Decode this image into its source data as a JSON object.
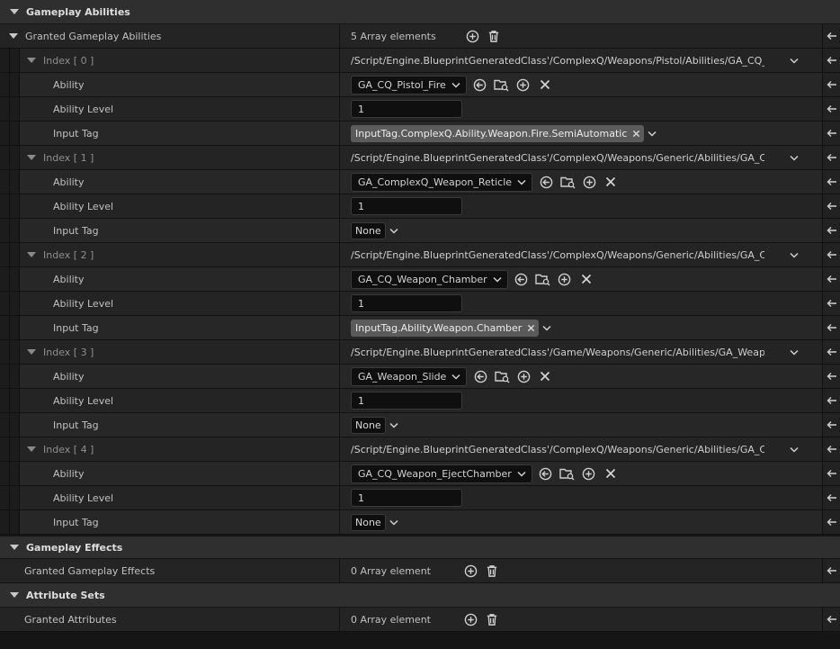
{
  "sections": [
    {
      "title": "Gameplay Abilities"
    },
    {
      "title": "Gameplay Effects"
    },
    {
      "title": "Attribute Sets"
    }
  ],
  "granted_abilities": {
    "label": "Granted Gameplay Abilities",
    "count_text": "5 Array elements",
    "items": [
      {
        "index_label": "Index [ 0 ]",
        "class_path": "/Script/Engine.BlueprintGeneratedClass'/ComplexQ/Weapons/Pistol/Abilities/GA_CQ_Pisto",
        "ability_label": "Ability",
        "ability": "GA_CQ_Pistol_Fire",
        "level_label": "Ability Level",
        "level": "1",
        "tag_label": "Input Tag",
        "tag": "InputTag.ComplexQ.Ability.Weapon.Fire.SemiAutomatic"
      },
      {
        "index_label": "Index [ 1 ]",
        "class_path": "/Script/Engine.BlueprintGeneratedClass'/ComplexQ/Weapons/Generic/Abilities/GA_Comple",
        "ability_label": "Ability",
        "ability": "GA_ComplexQ_Weapon_Reticle",
        "level_label": "Ability Level",
        "level": "1",
        "tag_label": "Input Tag",
        "tag": "None"
      },
      {
        "index_label": "Index [ 2 ]",
        "class_path": "/Script/Engine.BlueprintGeneratedClass'/ComplexQ/Weapons/Generic/Abilities/GA_CQ_Wea",
        "ability_label": "Ability",
        "ability": "GA_CQ_Weapon_Chamber",
        "level_label": "Ability Level",
        "level": "1",
        "tag_label": "Input Tag",
        "tag": "InputTag.Ability.Weapon.Chamber"
      },
      {
        "index_label": "Index [ 3 ]",
        "class_path": "/Script/Engine.BlueprintGeneratedClass'/Game/Weapons/Generic/Abilities/GA_Weapon_Slic",
        "ability_label": "Ability",
        "ability": "GA_Weapon_Slide",
        "level_label": "Ability Level",
        "level": "1",
        "tag_label": "Input Tag",
        "tag": "None"
      },
      {
        "index_label": "Index [ 4 ]",
        "class_path": "/Script/Engine.BlueprintGeneratedClass'/ComplexQ/Weapons/Generic/Abilities/GA_CQ_Wea",
        "ability_label": "Ability",
        "ability": "GA_CQ_Weapon_EjectChamber",
        "level_label": "Ability Level",
        "level": "1",
        "tag_label": "Input Tag",
        "tag": "None"
      }
    ]
  },
  "granted_effects": {
    "label": "Granted Gameplay Effects",
    "count_text": "0 Array element"
  },
  "granted_attributes": {
    "label": "Granted Attributes",
    "count_text": "0 Array element"
  },
  "icons": {
    "collapse": "chevron-down-icon",
    "add": "add-element-icon",
    "delete": "trash-icon",
    "reset": "reset-to-default-icon",
    "browse": "use-selected-icon",
    "find": "browse-asset-icon",
    "clear": "clear-icon"
  }
}
